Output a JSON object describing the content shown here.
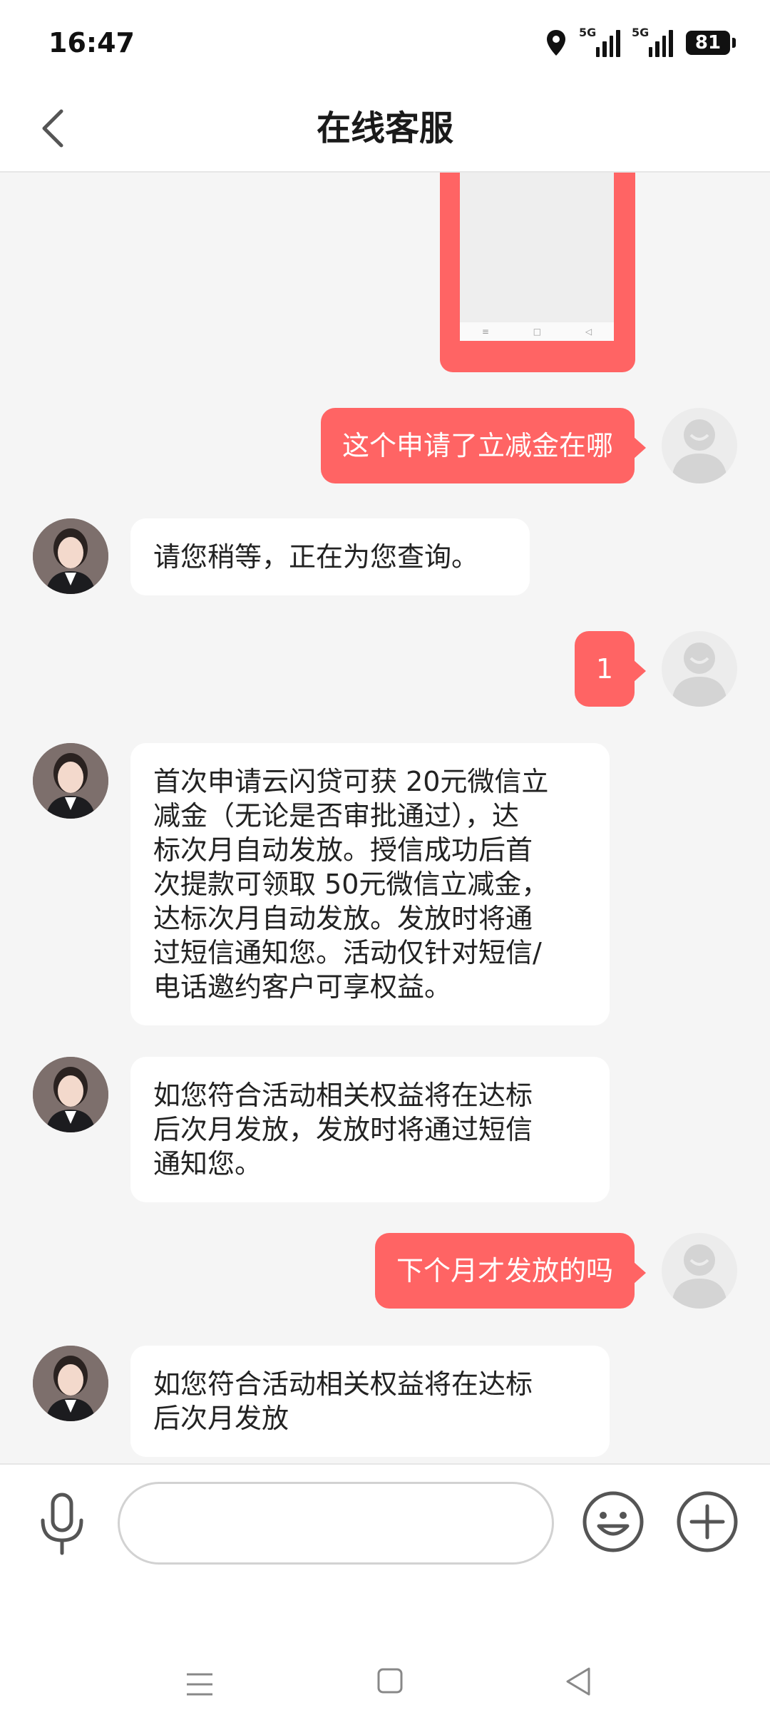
{
  "status_bar": {
    "time": "16:47",
    "net1": "5G",
    "net2": "5G",
    "battery": "81"
  },
  "header": {
    "title": "在线客服"
  },
  "messages": [
    {
      "from": "user",
      "text": "这个申请了立减金在哪"
    },
    {
      "from": "agent",
      "text": "请您稍等，正在为您查询。"
    },
    {
      "from": "user",
      "text": "1"
    },
    {
      "from": "agent",
      "text": "首次申请云闪贷可获 20元微信立\n减金（无论是否审批通过），达\n标次月自动发放。授信成功后首\n次提款可领取 50元微信立减金，\n达标次月自动发放。发放时将通\n过短信通知您。活动仅针对短信/\n电话邀约客户可享权益。"
    },
    {
      "from": "agent",
      "text": "如您符合活动相关权益将在达标\n后次月发放，发放时将通过短信\n通知您。"
    },
    {
      "from": "user",
      "text": "下个月才发放的吗"
    },
    {
      "from": "agent",
      "text": "如您符合活动相关权益将在达标\n后次月发放"
    }
  ],
  "input": {
    "value": "",
    "placeholder": ""
  },
  "colors": {
    "accent": "#ff6464",
    "background": "#f5f5f5"
  }
}
